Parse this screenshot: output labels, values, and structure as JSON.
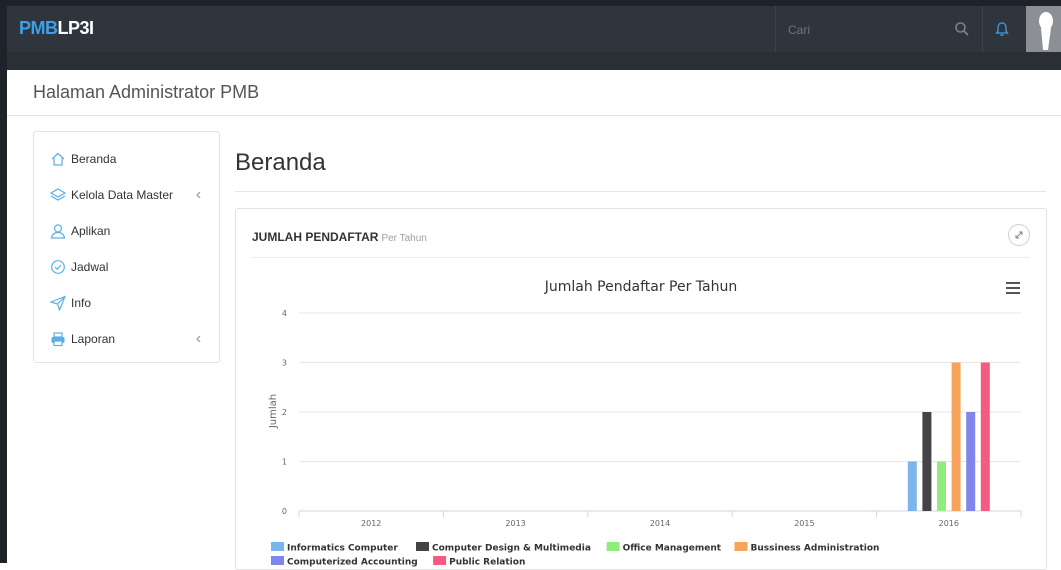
{
  "topbar": {
    "logo_part1": "PMB",
    "logo_part2": "LP3I",
    "search_placeholder": "Cari",
    "search_icon": "search-icon",
    "notification_icon": "bell-icon"
  },
  "page_header": {
    "title": "Halaman Administrator PMB"
  },
  "sidebar": {
    "items": [
      {
        "label": "Beranda",
        "icon": "home-icon",
        "has_submenu": false
      },
      {
        "label": "Kelola Data Master",
        "icon": "layers-icon",
        "has_submenu": true
      },
      {
        "label": "Aplikan",
        "icon": "user-icon",
        "has_submenu": false
      },
      {
        "label": "Jadwal",
        "icon": "check-circle-icon",
        "has_submenu": false
      },
      {
        "label": "Info",
        "icon": "paper-plane-icon",
        "has_submenu": false
      },
      {
        "label": "Laporan",
        "icon": "printer-icon",
        "has_submenu": true
      }
    ]
  },
  "content": {
    "title": "Beranda"
  },
  "panel": {
    "title": "JUMLAH PENDAFTAR",
    "subtitle": "Per Tahun",
    "expand_icon": "expand-icon",
    "menu_icon": "hamburger-menu-icon"
  },
  "colors": {
    "accent": "#3aa0e8",
    "topbar": "#2f353d"
  },
  "chart_data": {
    "type": "bar",
    "title": "Jumlah Pendaftar Per Tahun",
    "xlabel": "",
    "ylabel": "Jumlah",
    "categories": [
      "2012",
      "2013",
      "2014",
      "2015",
      "2016"
    ],
    "ylim": [
      0,
      4
    ],
    "yticks": [
      0,
      1,
      2,
      3,
      4
    ],
    "grid": true,
    "legend_position": "bottom",
    "series": [
      {
        "name": "Informatics Computer",
        "color": "#7cb5ec",
        "values": [
          0,
          0,
          0,
          0,
          1
        ]
      },
      {
        "name": "Computer Design & Multimedia",
        "color": "#434348",
        "values": [
          0,
          0,
          0,
          0,
          2
        ]
      },
      {
        "name": "Office Management",
        "color": "#90ed7d",
        "values": [
          0,
          0,
          0,
          0,
          1
        ]
      },
      {
        "name": "Bussiness Administration",
        "color": "#f7a35c",
        "values": [
          0,
          0,
          0,
          0,
          3
        ]
      },
      {
        "name": "Computerized Accounting",
        "color": "#8085e9",
        "values": [
          0,
          0,
          0,
          0,
          2
        ]
      },
      {
        "name": "Public Relation",
        "color": "#f15c80",
        "values": [
          0,
          0,
          0,
          0,
          3
        ]
      }
    ]
  }
}
